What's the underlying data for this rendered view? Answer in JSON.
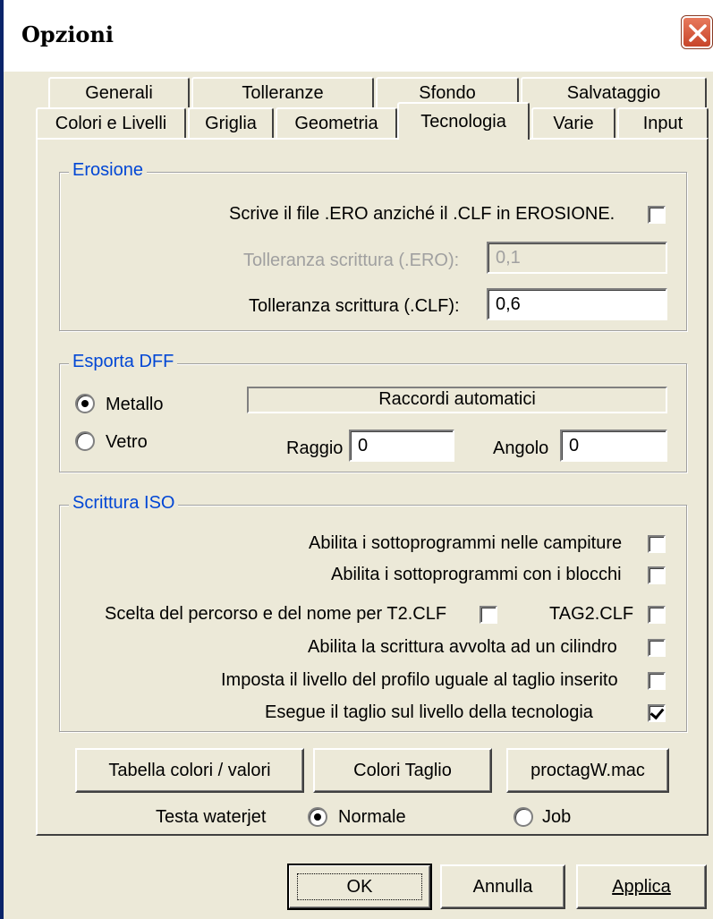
{
  "window": {
    "title": "Opzioni"
  },
  "tabs": {
    "row1": [
      "Generali",
      "Tolleranze",
      "Sfondo",
      "Salvataggio"
    ],
    "row2": [
      "Colori e Livelli",
      "Griglia",
      "Geometria",
      "Tecnologia",
      "Varie",
      "Input"
    ],
    "active": "Tecnologia"
  },
  "erosione": {
    "title": "Erosione",
    "write_ero_label": "Scrive il file .ERO anziché il .CLF in EROSIONE.",
    "write_ero_checked": false,
    "tol_ero_label": "Tolleranza scrittura (.ERO):",
    "tol_ero_value": "0,1",
    "tol_clf_label": "Tolleranza scrittura (.CLF):",
    "tol_clf_value": "0,6"
  },
  "esporta_dff": {
    "title": "Esporta DFF",
    "metallo_label": "Metallo",
    "vetro_label": "Vetro",
    "selected": "Metallo",
    "raccordi_label": "Raccordi automatici",
    "raggio_label": "Raggio",
    "raggio_value": "0",
    "angolo_label": "Angolo",
    "angolo_value": "0"
  },
  "scrittura_iso": {
    "title": "Scrittura ISO",
    "options": [
      {
        "label": "Abilita i sottoprogrammi nelle campiture",
        "checked": false
      },
      {
        "label": "Abilita i sottoprogrammi con i blocchi",
        "checked": false
      },
      {
        "label": "Scelta del percorso e del nome per T2.CLF",
        "checked": false
      },
      {
        "label": "TAG2.CLF",
        "checked": false
      },
      {
        "label": "Abilita la scrittura avvolta ad un cilindro",
        "checked": false
      },
      {
        "label": "Imposta il livello del profilo uguale al taglio inserito",
        "checked": false
      },
      {
        "label": "Esegue il taglio sul livello della tecnologia",
        "checked": true
      }
    ]
  },
  "buttons": {
    "tabella": "Tabella colori / valori",
    "colori_taglio": "Colori Taglio",
    "proctag": "proctagW.mac"
  },
  "testa_waterjet": {
    "label": "Testa waterjet",
    "normale": "Normale",
    "job": "Job",
    "selected": "Normale"
  },
  "footer": {
    "ok": "OK",
    "annulla": "Annulla",
    "applica": "Applica"
  }
}
